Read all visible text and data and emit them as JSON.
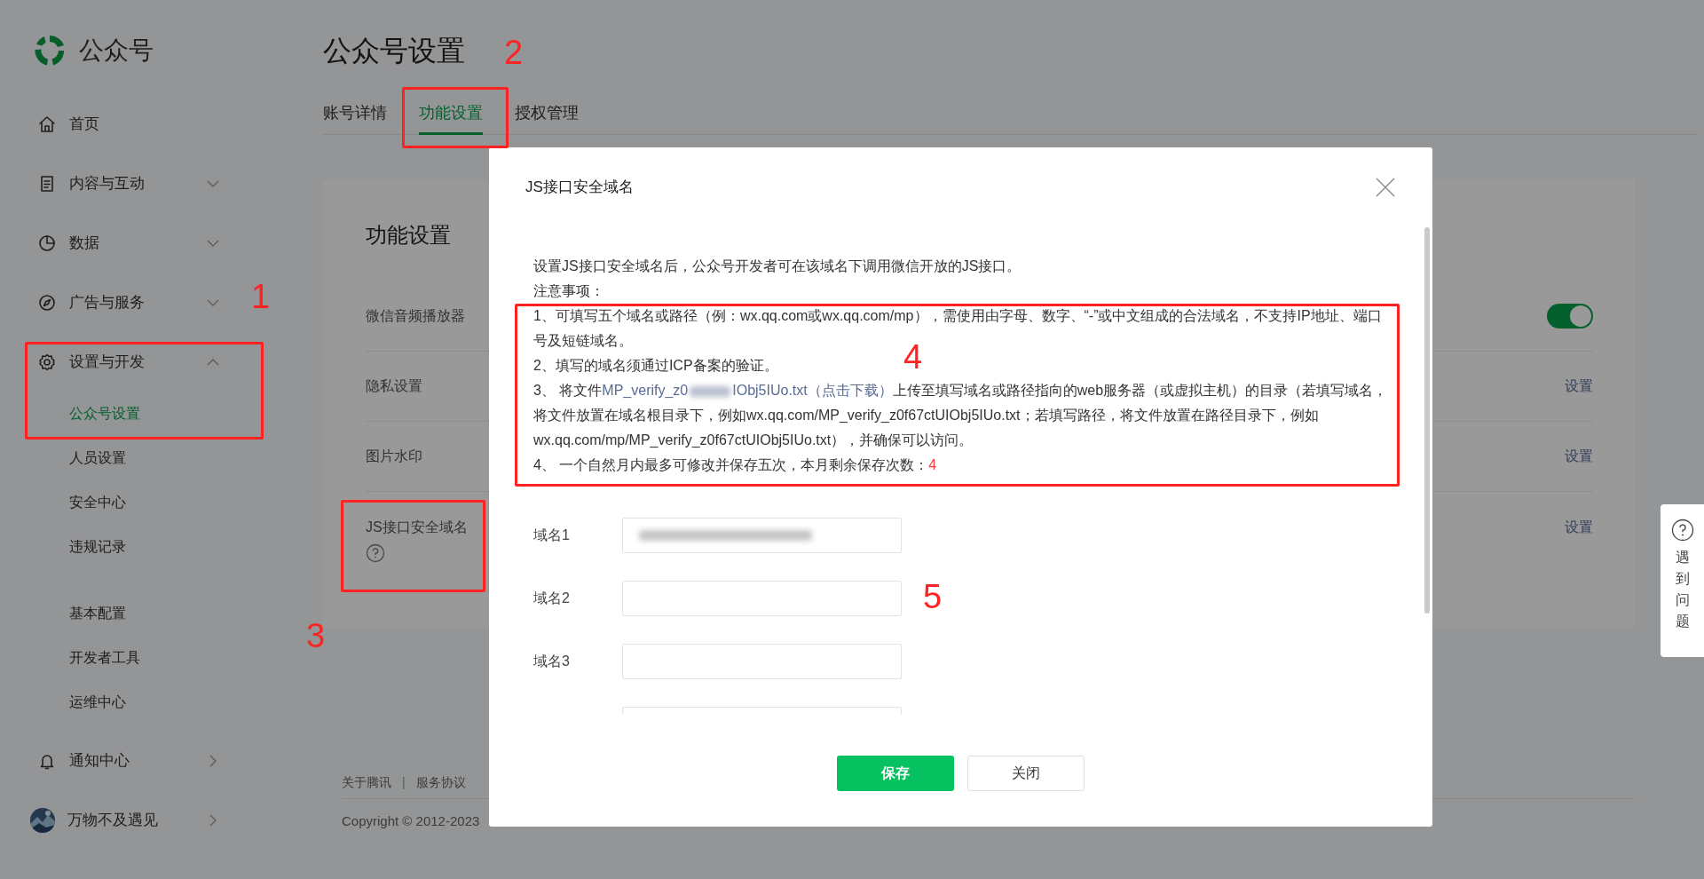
{
  "sidebar": {
    "logo": "公众号",
    "items": [
      {
        "label": "首页",
        "kind": "plain"
      },
      {
        "label": "内容与互动",
        "kind": "group",
        "expanded": false
      },
      {
        "label": "数据",
        "kind": "group",
        "expanded": false
      },
      {
        "label": "广告与服务",
        "kind": "group",
        "expanded": false
      },
      {
        "label": "设置与开发",
        "kind": "group",
        "expanded": true,
        "children": [
          {
            "items": [
              {
                "label": "公众号设置",
                "selected": true
              },
              {
                "label": "人员设置",
                "selected": false
              },
              {
                "label": "安全中心",
                "selected": false
              },
              {
                "label": "违规记录",
                "selected": false
              }
            ]
          },
          {
            "items": [
              {
                "label": "基本配置",
                "selected": false
              },
              {
                "label": "开发者工具",
                "selected": false
              },
              {
                "label": "运维中心",
                "selected": false
              }
            ]
          }
        ]
      },
      {
        "label": "通知中心",
        "kind": "link"
      },
      {
        "label": "万物不及遇见",
        "kind": "account"
      }
    ]
  },
  "page": {
    "title": "公众号设置",
    "tabs": [
      {
        "label": "账号详情",
        "selected": false
      },
      {
        "label": "功能设置",
        "selected": true
      },
      {
        "label": "授权管理",
        "selected": false
      }
    ],
    "card": {
      "title": "功能设置",
      "rows": [
        {
          "label": "微信音频播放器",
          "kind": "toggle",
          "on": true
        },
        {
          "label": "隐私设置",
          "kind": "link",
          "action": "设置"
        },
        {
          "label": "图片水印",
          "kind": "link",
          "action": "设置"
        },
        {
          "label": "JS接口安全域名",
          "kind": "link",
          "action": "设置",
          "help": true
        }
      ]
    },
    "footer": {
      "links": [
        "关于腾讯",
        "服务协议"
      ],
      "separator": "|",
      "copyright": "Copyright © 2012-2023"
    }
  },
  "dialog": {
    "title": "JS接口安全域名",
    "intro": "设置JS接口安全域名后，公众号开发者可在该域名下调用微信开放的JS接口。",
    "notes_label": "注意事项：",
    "notes": [
      {
        "kind": "text",
        "text": "1、可填写五个域名或路径（例：wx.qq.com或wx.qq.com/mp），需使用由字母、数字、“-”或中文组成的合法域名，不支持IP地址、端口号及短链域名。"
      },
      {
        "kind": "text",
        "text": "2、填写的域名须通过ICP备案的验证。"
      },
      {
        "kind": "file",
        "before": "3、 将文件",
        "link_start": "MP_verify_z0",
        "link_end": "IObj5IUo.txt（点击下载）",
        "after": "上传至填写域名或路径指向的web服务器（或虚拟主机）的目录（若填写域名，将文件放置在域名根目录下，例如wx.qq.com/MP_verify_z0f67ctUIObj5IUo.txt；若填写路径，将文件放置在路径目录下，例如wx.qq.com/mp/MP_verify_z0f67ctUIObj5IUo.txt），并确保可以访问。"
      },
      {
        "kind": "count",
        "text": "4、 一个自然月内最多可修改并保存五次，本月剩余保存次数：",
        "count": "4"
      }
    ],
    "fields": [
      {
        "label": "域名1",
        "kind": "blurred"
      },
      {
        "label": "域名2",
        "kind": "empty"
      },
      {
        "label": "域名3",
        "kind": "empty"
      },
      {
        "kind": "cut"
      }
    ],
    "buttons": [
      {
        "label": "保存",
        "kind": "primary"
      },
      {
        "label": "关闭",
        "kind": "default"
      }
    ]
  },
  "help_widget": {
    "label": "遇到问题"
  },
  "annotations": [
    "1",
    "2",
    "3",
    "4",
    "5"
  ]
}
